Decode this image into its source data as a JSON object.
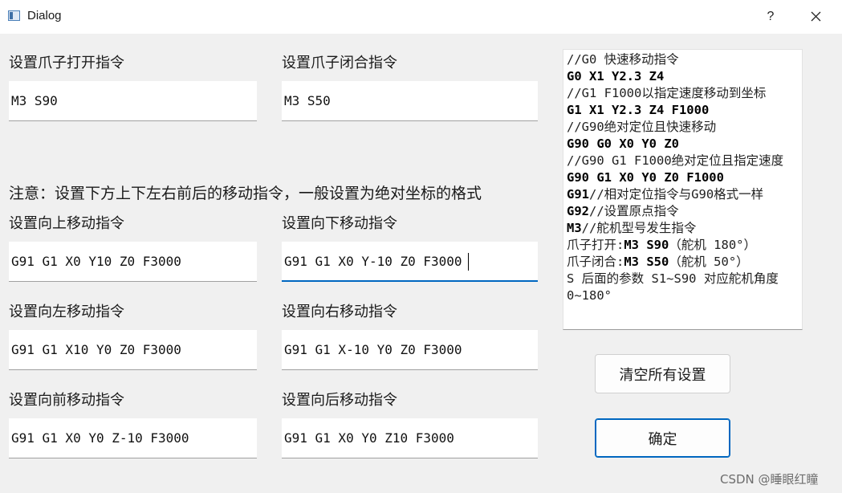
{
  "window": {
    "title": "Dialog",
    "help_label": "?"
  },
  "labels": {
    "claw_open": "设置爪子打开指令",
    "claw_close": "设置爪子闭合指令",
    "note": "注意：设置下方上下左右前后的移动指令，一般设置为绝对坐标的格式",
    "up": "设置向上移动指令",
    "down": "设置向下移动指令",
    "left": "设置向左移动指令",
    "right": "设置向右移动指令",
    "forward": "设置向前移动指令",
    "backward": "设置向后移动指令"
  },
  "fields": {
    "claw_open": "M3 S90",
    "claw_close": "M3 S50",
    "up": "G91 G1 X0 Y10 Z0 F3000",
    "down": "G91 G1 X0 Y-10 Z0 F3000",
    "left": "G91 G1 X10 Y0 Z0 F3000",
    "right": "G91 G1 X-10 Y0 Z0 F3000",
    "forward": "G91 G1 X0 Y0 Z-10 F3000",
    "backward": "G91 G1 X0 Y0 Z10 F3000"
  },
  "help": {
    "l1": "//G0 快速移动指令",
    "l2": "G0 X1 Y2.3 Z4",
    "l3": "//G1 F1000以指定速度移动到坐标",
    "l4": "G1 X1 Y2.3 Z4 F1000",
    "l5": "//G90绝对定位且快速移动",
    "l6": "G90 G0 X0 Y0 Z0",
    "l7": "//G90 G1 F1000绝对定位且指定速度",
    "l8": "G90 G1 X0 Y0 Z0 F1000",
    "l9a": "G91",
    "l9b": "//相对定位指令与G90格式一样",
    "l10a": "G92",
    "l10b": "//设置原点指令",
    "l11a": "M3",
    "l11b": "//舵机型号发生指令",
    "l12a": "爪子打开:",
    "l12b": "M3 S90",
    "l12c": "（舵机 180°）",
    "l13a": "爪子闭合:",
    "l13b": "M3 S50",
    "l13c": "（舵机 50°）",
    "l14": "S 后面的参数 S1~S90 对应舵机角度",
    "l15": "0~180°"
  },
  "buttons": {
    "clear": "清空所有设置",
    "ok": "确定"
  },
  "watermark": "CSDN @睡眼红瞳",
  "colors": {
    "background": "#f0f0f0",
    "accent": "#0067c0"
  },
  "icons": {
    "app": "dialog-window-icon",
    "close": "close-icon"
  }
}
